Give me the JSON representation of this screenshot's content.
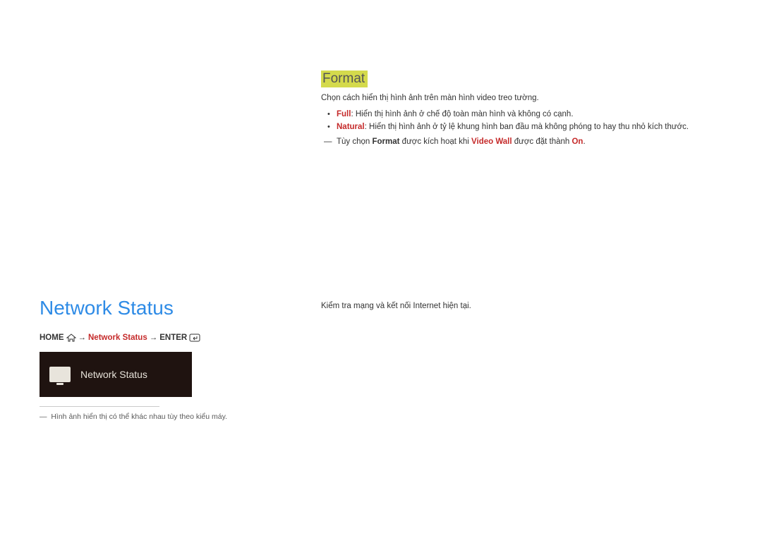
{
  "format": {
    "heading": "Format",
    "intro": "Chọn cách hiển thị hình ảnh trên màn hình video treo tường.",
    "bullets": [
      {
        "label": "Full",
        "desc": ": Hiển thị hình ảnh ở chế độ toàn màn hình và không có cạnh."
      },
      {
        "label": "Natural",
        "desc": ": Hiển thị hình ảnh ở tỷ lệ khung hình ban đầu mà không phóng to hay thu nhỏ kích thước."
      }
    ],
    "note_prefix": "Tùy chọn ",
    "note_bold1": "Format",
    "note_mid": " được kích hoạt khi ",
    "note_red": "Video Wall",
    "note_after": " được đặt thành ",
    "note_on": "On",
    "note_end": "."
  },
  "network": {
    "title": "Network Status",
    "breadcrumb": {
      "home": "HOME",
      "arrow1": " → ",
      "link": "Network Status",
      "arrow2": " → ",
      "enter": "ENTER"
    },
    "tile_label": "Network Status",
    "footnote_dash": "―",
    "footnote": "Hình ảnh hiển thị có thể khác nhau tùy theo kiểu máy.",
    "body": "Kiểm tra mạng và kết nối Internet hiện tại."
  }
}
